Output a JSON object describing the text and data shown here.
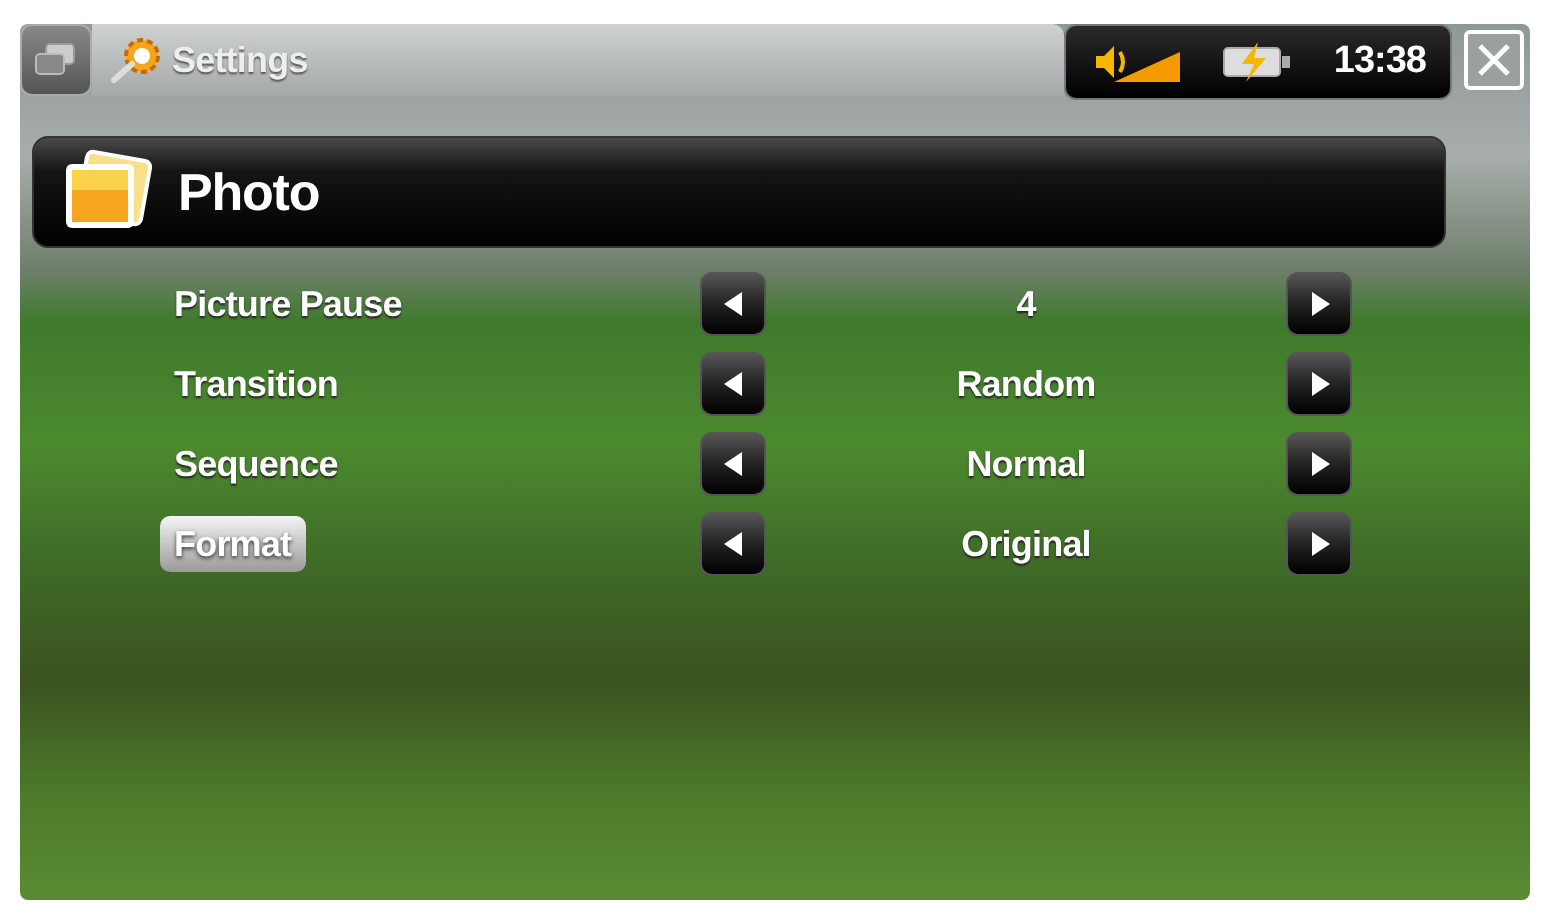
{
  "top_bar": {
    "title": "Settings",
    "time": "13:38"
  },
  "header": {
    "title": "Photo"
  },
  "settings": [
    {
      "label": "Picture Pause",
      "value": "4",
      "selected": false
    },
    {
      "label": "Transition",
      "value": "Random",
      "selected": false
    },
    {
      "label": "Sequence",
      "value": "Normal",
      "selected": false
    },
    {
      "label": "Format",
      "value": "Original",
      "selected": true
    }
  ]
}
